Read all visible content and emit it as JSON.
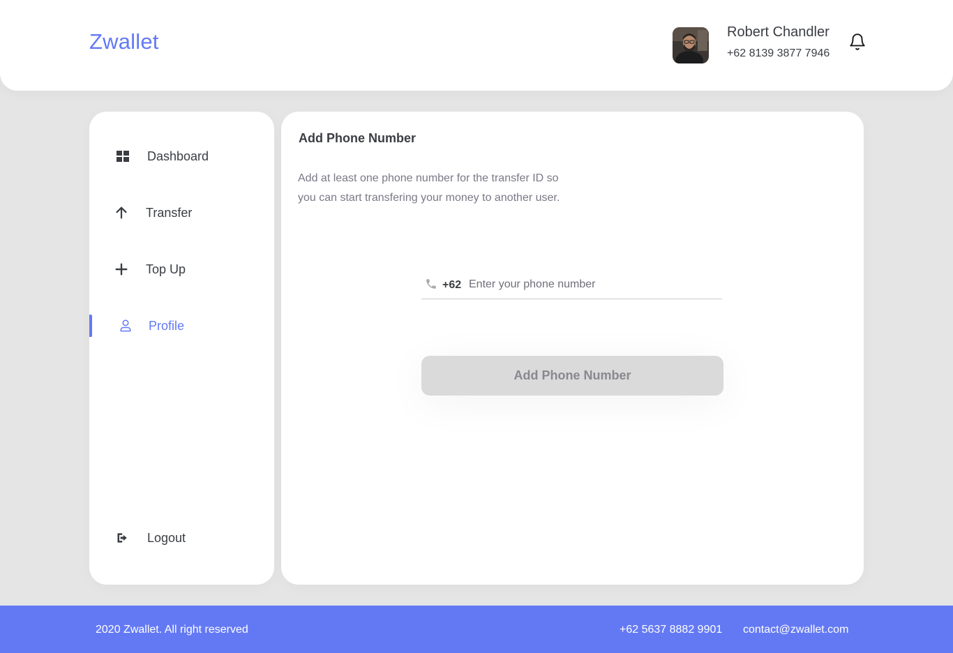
{
  "header": {
    "brand": "Zwallet",
    "user": {
      "name": "Robert Chandler",
      "phone": "+62 8139 3877 7946",
      "avatar_icon": "user-photo-avatar"
    },
    "notification_icon": "bell-icon"
  },
  "sidebar": {
    "items": [
      {
        "label": "Dashboard",
        "icon": "grid-icon",
        "active": false
      },
      {
        "label": "Transfer",
        "icon": "arrow-up-icon",
        "active": false
      },
      {
        "label": "Top Up",
        "icon": "plus-icon",
        "active": false
      },
      {
        "label": "Profile",
        "icon": "user-icon",
        "active": true
      }
    ],
    "logout": {
      "label": "Logout",
      "icon": "logout-icon"
    }
  },
  "main": {
    "title": "Add Phone Number",
    "description_line1": "Add at least one phone number for the transfer ID so",
    "description_line2": "you can start transfering your money to another user.",
    "phone_field": {
      "prefix": "+62",
      "placeholder": "Enter your phone number",
      "value": "",
      "icon": "phone-icon"
    },
    "submit_label": "Add Phone Number"
  },
  "footer": {
    "copyright": "2020 Zwallet. All right reserved",
    "phone": "+62 5637 8882 9901",
    "email": "contact@zwallet.com"
  },
  "colors": {
    "accent": "#6379f4",
    "background": "#e5e5e5",
    "text": "#3a3d42",
    "muted": "#7a7886",
    "button_disabled": "#dadada"
  }
}
